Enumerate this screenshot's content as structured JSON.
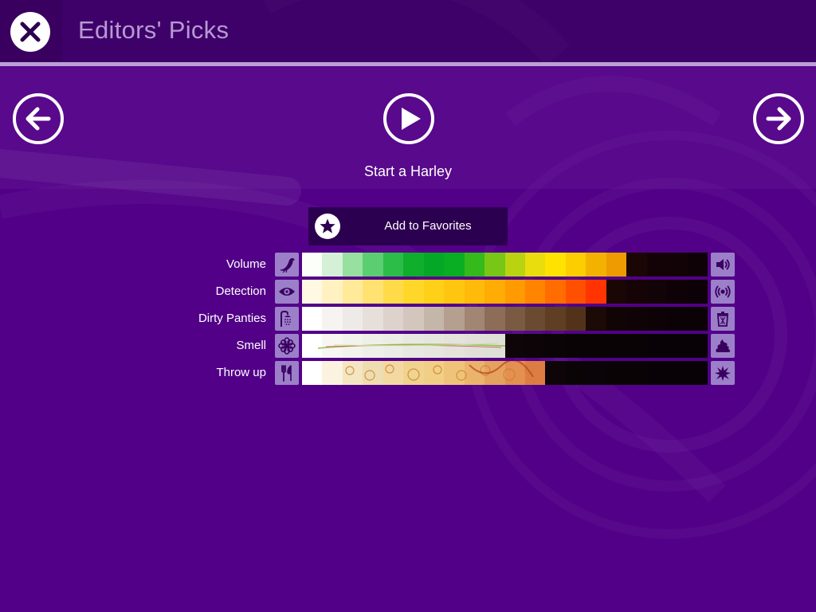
{
  "header": {
    "title": "Editors' Picks"
  },
  "nav": {
    "start_label": "Start a Harley"
  },
  "favorites": {
    "label": "Add to Favorites"
  },
  "meters": [
    {
      "label": "Volume",
      "left_icon": "bird-icon",
      "right_icon": "speaker-icon",
      "level": 0.8,
      "colors": [
        "#fcfff9",
        "#d4f1d8",
        "#98e0a0",
        "#5cce72",
        "#2bbd48",
        "#0fae2d",
        "#05a826",
        "#0aae22",
        "#35ba1c",
        "#78c616",
        "#b9d311",
        "#eadd0d",
        "#ffe200",
        "#fccd00",
        "#f4b200",
        "#ed9b00",
        "#1b0606",
        "#140306",
        "#110306",
        "#0e0207"
      ]
    },
    {
      "label": "Detection",
      "left_icon": "eye-icon",
      "right_icon": "radio-waves-icon",
      "level": 0.7,
      "colors": [
        "#fff8e3",
        "#fff2c0",
        "#ffea9a",
        "#ffe271",
        "#ffdb4a",
        "#ffd729",
        "#ffd018",
        "#ffc610",
        "#ffba0a",
        "#ffac05",
        "#ff9a00",
        "#ff8400",
        "#ff6c00",
        "#ff5000",
        "#ff3400",
        "#1b0606",
        "#150306",
        "#120306",
        "#0f0207",
        "#0c0106"
      ]
    },
    {
      "label": "Dirty Panties",
      "left_icon": "shower-icon",
      "right_icon": "trash-can-icon",
      "level": 0.7,
      "colors": [
        "#ffffff",
        "#f6f3f1",
        "#eeeae7",
        "#e6dfda",
        "#ddd3cc",
        "#d2c6bd",
        "#c5b6aa",
        "#b59f8f",
        "#a28674",
        "#8d6d58",
        "#7a5a43",
        "#6b4a32",
        "#5f3e24",
        "#52331a",
        "#1b0a06",
        "#110405",
        "#0f0305",
        "#0d0205",
        "#0b0205",
        "#0a0205"
      ]
    },
    {
      "label": "Smell",
      "left_icon": "flower-icon",
      "right_icon": "poop-icon",
      "level": 0.5,
      "colors": [
        "#ffffff",
        "#f7f6f2",
        "#f3f3ee",
        "#efefe9",
        "#ecece6",
        "#e8e8e2",
        "#e6e6df",
        "#e3e3dc",
        "#e0e0d9",
        "#dedfd7",
        "#0e0508",
        "#0c0407",
        "#0b0407",
        "#0a0306",
        "#0a0306",
        "#090306",
        "#090306",
        "#080206",
        "#080206",
        "#080206"
      ]
    },
    {
      "label": "Throw up",
      "left_icon": "fork-knife-icon",
      "right_icon": "splat-icon",
      "level": 0.6,
      "colors": [
        "#ffffff",
        "#fbf3e0",
        "#f4e6c2",
        "#eeddb0",
        "#f3d9a1",
        "#f0d38e",
        "#f1cf86",
        "#efc47a",
        "#ebb46d",
        "#e6a25f",
        "#e49050",
        "#dd7d43",
        "#0d0508",
        "#0b0407",
        "#0a0307",
        "#090306",
        "#090306",
        "#080206",
        "#080206",
        "#080206"
      ]
    }
  ]
}
